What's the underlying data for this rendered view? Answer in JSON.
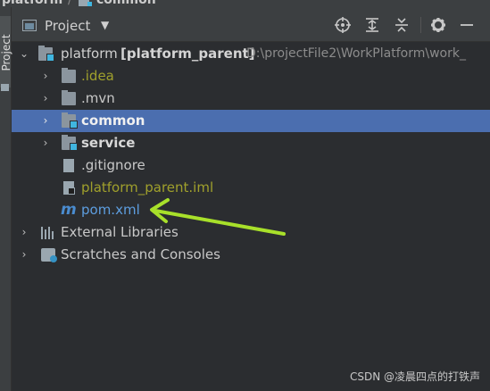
{
  "breadcrumb": {
    "project": "platform",
    "separator": "/",
    "module": "common"
  },
  "side_tab": {
    "label": "Project"
  },
  "panel": {
    "title": "Project",
    "dropdown_icon": "chevron-down-icon",
    "tools": [
      "locate-icon",
      "expand-all-icon",
      "collapse-all-icon",
      "gear-icon",
      "minimize-icon"
    ]
  },
  "tree": {
    "root": {
      "name": "platform",
      "module": "[platform_parent]",
      "path": "D:\\projectFile2\\WorkPlatform\\work_"
    },
    "idea": ".idea",
    "mvn": ".mvn",
    "common": "common",
    "service": "service",
    "gitignore": ".gitignore",
    "iml": "platform_parent.iml",
    "pom": "pom.xml",
    "maven_glyph": "m",
    "external": "External Libraries",
    "scratches": "Scratches and Consoles"
  },
  "colors": {
    "selection": "#4b6eaf",
    "ignored_file": "#a0a02c",
    "module_accent": "#40b6e0",
    "annotation_arrow": "#a8e02a"
  },
  "watermark": "CSDN @凌晨四点的打铁声"
}
